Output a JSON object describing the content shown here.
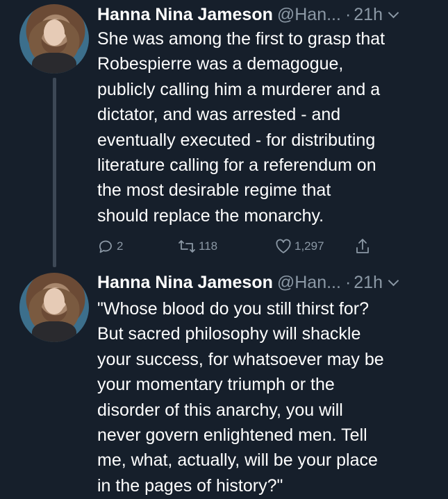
{
  "tweets": [
    {
      "author_name": "Hanna Nina Jameson",
      "handle": "@Han...",
      "separator": "·",
      "time": "21h",
      "text": "She was among the first to grasp that\nRobespierre was a demagogue,\npublicly calling him a murderer and a\ndictator, and was arrested - and\neventually executed - for distributing\nliterature calling for a referendum on\nthe most desirable regime that\nshould replace the monarchy.",
      "replies": "2",
      "retweets": "118",
      "likes": "1,297"
    },
    {
      "author_name": "Hanna Nina Jameson",
      "handle": "@Han...",
      "separator": "·",
      "time": "21h",
      "text": "\"Whose blood do you still thirst for?\nBut sacred philosophy will shackle\nyour success, for whatsoever may be\nyour momentary triumph or the\ndisorder of this anarchy, you will\nnever govern enlightened men. Tell\nme, what, actually, will be your place\nin the pages of history?\""
    }
  ],
  "colors": {
    "background": "#161f2b",
    "text": "#ffffff",
    "secondary": "#8b98a5",
    "thread_line": "#3d4856"
  },
  "icons": [
    "reply-icon",
    "retweet-icon",
    "like-icon",
    "share-icon",
    "chevron-down-icon"
  ]
}
